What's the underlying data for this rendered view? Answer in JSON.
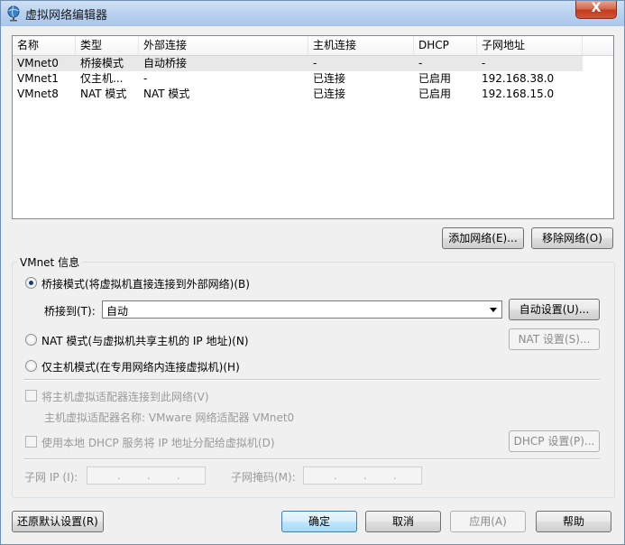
{
  "window": {
    "title": "虚拟网络编辑器",
    "close_label": "X"
  },
  "table": {
    "columns": [
      "名称",
      "类型",
      "外部连接",
      "主机连接",
      "DHCP",
      "子网地址"
    ],
    "rows": [
      [
        "VMnet0",
        "桥接模式",
        "自动桥接",
        "-",
        "-",
        "-"
      ],
      [
        "VMnet1",
        "仅主机...",
        "-",
        "已连接",
        "已启用",
        "192.168.38.0"
      ],
      [
        "VMnet8",
        "NAT 模式",
        "NAT 模式",
        "已连接",
        "已启用",
        "192.168.15.0"
      ]
    ]
  },
  "table_buttons": {
    "add": "添加网络(E)...",
    "remove": "移除网络(O)"
  },
  "vmnet_info": {
    "title": "VMnet 信息",
    "bridged_radio": "桥接模式(将虚拟机直接连接到外部网络)(B)",
    "bridge_to_label": "桥接到(T):",
    "bridge_to_value": "自动",
    "auto_settings": "自动设置(U)...",
    "nat_radio": "NAT 模式(与虚拟机共享主机的 IP 地址)(N)",
    "nat_settings": "NAT 设置(S)...",
    "hostonly_radio": "仅主机模式(在专用网络内连接虚拟机)(H)",
    "connect_adapter_check": "将主机虚拟适配器连接到此网络(V)",
    "adapter_name": "主机虚拟适配器名称: VMware 网络适配器 VMnet0",
    "dhcp_check": "使用本地 DHCP 服务将 IP 地址分配给虚拟机(D)",
    "dhcp_settings": "DHCP 设置(P)...",
    "subnet_ip_label": "子网 IP (I):",
    "subnet_mask_label": "子网掩码(M):",
    "ip_dot": "."
  },
  "footer": {
    "restore": "还原默认设置(R)",
    "ok": "确定",
    "cancel": "取消",
    "apply": "应用(A)",
    "help": "帮助"
  },
  "colors": {
    "selection_row": "#e8e8e8",
    "titlebar": "#b7d0ee",
    "close": "#c53b1d"
  }
}
